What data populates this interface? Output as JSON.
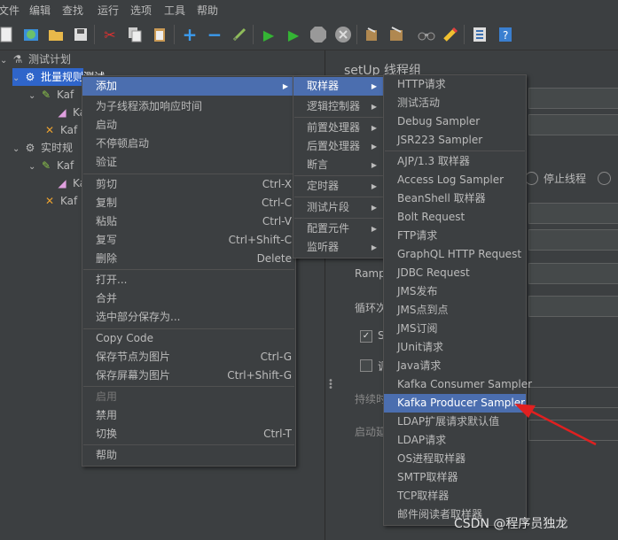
{
  "menubar": {
    "items": [
      "文件",
      "编辑",
      "查找",
      "运行",
      "选项",
      "工具",
      "帮助"
    ]
  },
  "toolbar": {
    "icons": [
      "new-icon",
      "templates-icon",
      "open-icon",
      "save-icon",
      "cut-icon",
      "copy-icon",
      "paste-icon",
      "expand-icon",
      "collapse-icon",
      "toggle-icon",
      "start-icon",
      "start-no-pause-icon",
      "stop-icon",
      "shutdown-icon",
      "clear-icon",
      "clear-all-icon",
      "search-icon",
      "reset-search-icon",
      "function-helper-icon",
      "help-icon"
    ]
  },
  "tree": {
    "items": [
      {
        "label": "测试计划",
        "icon": "flask-icon"
      },
      {
        "label": "批量规则测试",
        "icon": "gear-icon"
      },
      {
        "label": "Kaf",
        "icon": "pipette-icon"
      },
      {
        "label": "Kaf",
        "icon": "graph-icon"
      },
      {
        "label": "Kaf",
        "icon": "tools-icon"
      },
      {
        "label": "实时规",
        "icon": "gear-icon"
      },
      {
        "label": "Kaf",
        "icon": "pipette-icon"
      },
      {
        "label": "Kaf",
        "icon": "graph-icon"
      },
      {
        "label": "Kaf",
        "icon": "tools-icon"
      }
    ]
  },
  "right": {
    "title": "setUp 线程组",
    "stop_thread": "停止线程",
    "ramp": "Ramp",
    "loop": "循环次",
    "checkbox1": "S",
    "checkbox2": "调",
    "duration": "持续时",
    "startup_delay": "启动延"
  },
  "ctx1": {
    "items": [
      {
        "label": "添加",
        "submenu": true
      },
      {
        "label": "为子线程添加响应时间"
      },
      {
        "label": "启动"
      },
      {
        "label": "不停顿启动"
      },
      {
        "label": "验证"
      },
      {
        "label": "剪切",
        "shortcut": "Ctrl-X"
      },
      {
        "label": "复制",
        "shortcut": "Ctrl-C"
      },
      {
        "label": "粘贴",
        "shortcut": "Ctrl-V"
      },
      {
        "label": "复写",
        "shortcut": "Ctrl+Shift-C"
      },
      {
        "label": "删除",
        "shortcut": "Delete"
      },
      {
        "label": "打开..."
      },
      {
        "label": "合并"
      },
      {
        "label": "选中部分保存为..."
      },
      {
        "label": "Copy Code"
      },
      {
        "label": "保存节点为图片",
        "shortcut": "Ctrl-G"
      },
      {
        "label": "保存屏幕为图片",
        "shortcut": "Ctrl+Shift-G"
      },
      {
        "label": "启用"
      },
      {
        "label": "禁用"
      },
      {
        "label": "切换",
        "shortcut": "Ctrl-T"
      },
      {
        "label": "帮助"
      }
    ]
  },
  "ctx2": {
    "items": [
      {
        "label": "取样器"
      },
      {
        "label": "逻辑控制器"
      },
      {
        "label": "前置处理器"
      },
      {
        "label": "后置处理器"
      },
      {
        "label": "断言"
      },
      {
        "label": "定时器"
      },
      {
        "label": "测试片段"
      },
      {
        "label": "配置元件"
      },
      {
        "label": "监听器"
      }
    ]
  },
  "ctx3": {
    "items": [
      {
        "label": "HTTP请求"
      },
      {
        "label": "测试活动"
      },
      {
        "label": "Debug Sampler"
      },
      {
        "label": "JSR223 Sampler"
      },
      {
        "label": "AJP/1.3 取样器"
      },
      {
        "label": "Access Log Sampler"
      },
      {
        "label": "BeanShell 取样器"
      },
      {
        "label": "Bolt Request"
      },
      {
        "label": "FTP请求"
      },
      {
        "label": "GraphQL HTTP Request"
      },
      {
        "label": "JDBC Request"
      },
      {
        "label": "JMS发布"
      },
      {
        "label": "JMS点到点"
      },
      {
        "label": "JMS订阅"
      },
      {
        "label": "JUnit请求"
      },
      {
        "label": "Java请求"
      },
      {
        "label": "Kafka Consumer Sampler"
      },
      {
        "label": "Kafka Producer Sampler"
      },
      {
        "label": "LDAP扩展请求默认值"
      },
      {
        "label": "LDAP请求"
      },
      {
        "label": "OS进程取样器"
      },
      {
        "label": "SMTP取样器"
      },
      {
        "label": "TCP取样器"
      },
      {
        "label": "邮件阅读者取样器"
      }
    ]
  },
  "watermark": "CSDN @程序员独龙",
  "colors": {
    "highlight": "#4b6eaf",
    "tree_selection": "#2f65ca",
    "arrow": "#e02020"
  }
}
